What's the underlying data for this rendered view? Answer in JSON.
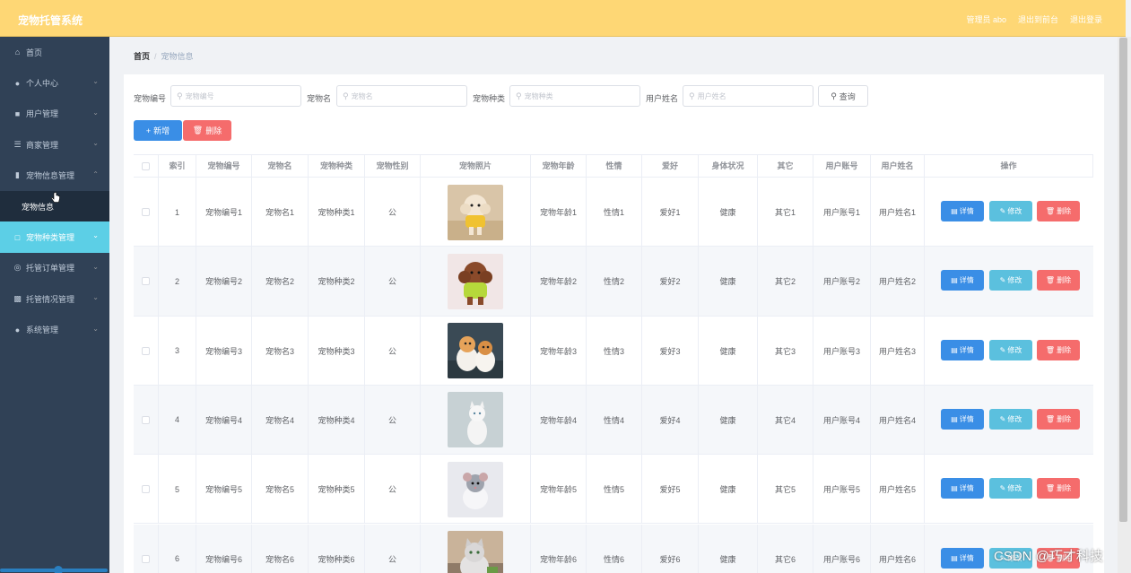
{
  "header": {
    "brand": "宠物托管系统",
    "user": "管理员 abo",
    "backend": "退出到前台",
    "logout": "退出登录"
  },
  "sidebar": {
    "items": [
      {
        "label": "首页",
        "icon": "home-icon",
        "arrow": false
      },
      {
        "label": "个人中心",
        "icon": "user-icon",
        "arrow": true
      },
      {
        "label": "用户管理",
        "icon": "chat-icon",
        "arrow": true
      },
      {
        "label": "商家管理",
        "icon": "menu-icon",
        "arrow": true
      },
      {
        "label": "宠物信息管理",
        "icon": "chart-icon",
        "arrow": true,
        "expanded": true
      },
      {
        "label": "宠物信息",
        "icon": "",
        "arrow": false,
        "sub": true
      },
      {
        "label": "宠物种类管理",
        "icon": "crop-icon",
        "arrow": true,
        "active": true
      },
      {
        "label": "托管订单管理",
        "icon": "globe-icon",
        "arrow": true
      },
      {
        "label": "托管情况管理",
        "icon": "clipboard-icon",
        "arrow": true
      },
      {
        "label": "系统管理",
        "icon": "location-icon",
        "arrow": true
      }
    ]
  },
  "breadcrumb": {
    "home": "首页",
    "sep": "/",
    "current": "宠物信息"
  },
  "filters": [
    {
      "label": "宠物编号",
      "placeholder": "宠物编号"
    },
    {
      "label": "宠物名",
      "placeholder": "宠物名"
    },
    {
      "label": "宠物种类",
      "placeholder": "宠物种类"
    },
    {
      "label": "用户姓名",
      "placeholder": "用户姓名"
    }
  ],
  "actions": {
    "query": "查询",
    "add": "新增",
    "delete": "删除",
    "detail": "详情",
    "edit": "修改",
    "remove": "删除"
  },
  "table": {
    "columns": [
      "索引",
      "宠物编号",
      "宠物名",
      "宠物种类",
      "宠物性别",
      "宠物照片",
      "宠物年龄",
      "性情",
      "爱好",
      "身体状况",
      "其它",
      "用户账号",
      "用户姓名",
      "操作"
    ],
    "rows": [
      {
        "index": "1",
        "code": "宠物编号1",
        "name": "宠物名1",
        "kind": "宠物种类1",
        "sex": "公",
        "photo": "dog-yellow",
        "age": "宠物年龄1",
        "temper": "性情1",
        "hobby": "爱好1",
        "health": "健康",
        "other": "其它1",
        "account": "用户账号1",
        "username": "用户姓名1"
      },
      {
        "index": "2",
        "code": "宠物编号2",
        "name": "宠物名2",
        "kind": "宠物种类2",
        "sex": "公",
        "photo": "dog-green",
        "age": "宠物年龄2",
        "temper": "性情2",
        "hobby": "爱好2",
        "health": "健康",
        "other": "其它2",
        "account": "用户账号2",
        "username": "用户姓名2"
      },
      {
        "index": "3",
        "code": "宠物编号3",
        "name": "宠物名3",
        "kind": "宠物种类3",
        "sex": "公",
        "photo": "cats-orange",
        "age": "宠物年龄3",
        "temper": "性情3",
        "hobby": "爱好3",
        "health": "健康",
        "other": "其它3",
        "account": "用户账号3",
        "username": "用户姓名3"
      },
      {
        "index": "4",
        "code": "宠物编号4",
        "name": "宠物名4",
        "kind": "宠物种类4",
        "sex": "公",
        "photo": "cat-white",
        "age": "宠物年龄4",
        "temper": "性情4",
        "hobby": "爱好4",
        "health": "健康",
        "other": "其它4",
        "account": "用户账号4",
        "username": "用户姓名4"
      },
      {
        "index": "5",
        "code": "宠物编号5",
        "name": "宠物名5",
        "kind": "宠物种类5",
        "sex": "公",
        "photo": "rat-grey",
        "age": "宠物年龄5",
        "temper": "性情5",
        "hobby": "爱好5",
        "health": "健康",
        "other": "其它5",
        "account": "用户账号5",
        "username": "用户姓名5"
      },
      {
        "index": "6",
        "code": "宠物编号6",
        "name": "宠物名6",
        "kind": "宠物种类6",
        "sex": "公",
        "photo": "cat-grey",
        "age": "宠物年龄6",
        "temper": "性情6",
        "hobby": "爱好6",
        "health": "健康",
        "other": "其它6",
        "account": "用户账号6",
        "username": "用户姓名6"
      }
    ]
  },
  "watermark": "CSDN @巧才科技",
  "colors": {
    "header": "#fed775",
    "sidebar": "#304156",
    "active": "#5ccfe6",
    "primary": "#3a8ee6",
    "danger": "#f56c6c",
    "info": "#5bc0de"
  }
}
